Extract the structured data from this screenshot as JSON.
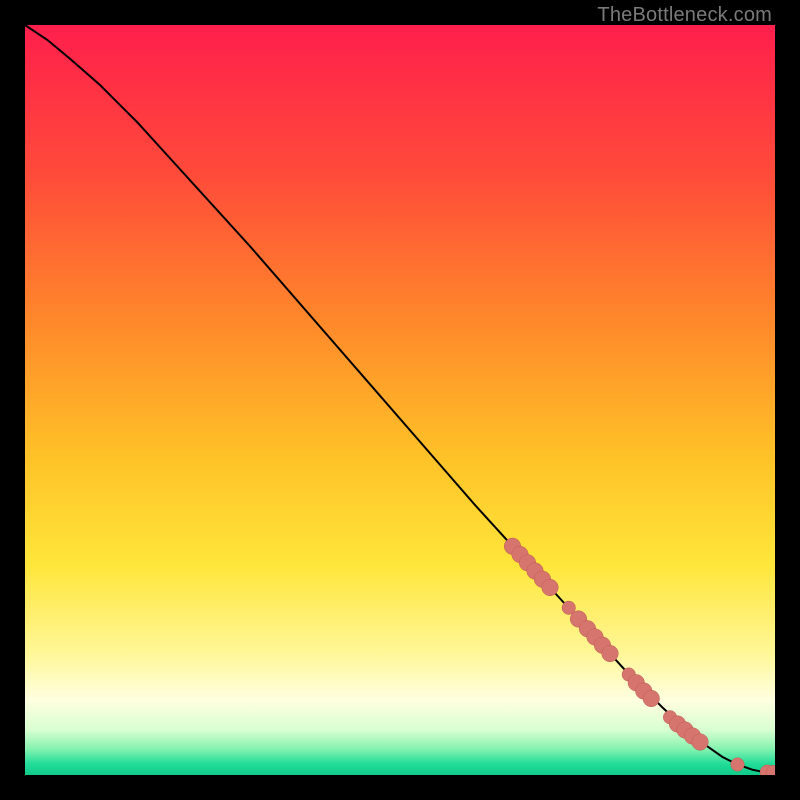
{
  "watermark": "TheBottleneck.com",
  "colors": {
    "frame": "#000000",
    "marker_fill": "#d6756e",
    "marker_stroke": "#c05a52",
    "curve": "#000000",
    "gradient_stops": [
      {
        "offset": 0.0,
        "color": "#ff1f4c"
      },
      {
        "offset": 0.2,
        "color": "#ff4b3a"
      },
      {
        "offset": 0.4,
        "color": "#ff8a2a"
      },
      {
        "offset": 0.58,
        "color": "#ffc328"
      },
      {
        "offset": 0.72,
        "color": "#ffe63a"
      },
      {
        "offset": 0.84,
        "color": "#fff79a"
      },
      {
        "offset": 0.9,
        "color": "#ffffe0"
      },
      {
        "offset": 0.94,
        "color": "#d8ffd0"
      },
      {
        "offset": 0.965,
        "color": "#86f2b0"
      },
      {
        "offset": 0.985,
        "color": "#22dd99"
      },
      {
        "offset": 1.0,
        "color": "#10c98a"
      }
    ]
  },
  "chart_data": {
    "type": "line",
    "title": "",
    "xlabel": "",
    "ylabel": "",
    "xlim": [
      0,
      100
    ],
    "ylim": [
      0,
      100
    ],
    "series": [
      {
        "name": "curve",
        "x": [
          0,
          3,
          6,
          10,
          15,
          20,
          30,
          40,
          50,
          60,
          65,
          70,
          75,
          80,
          85,
          88,
          91,
          93,
          95,
          97,
          98.5,
          100
        ],
        "y": [
          100,
          98,
          95.5,
          92,
          87,
          81.5,
          70.5,
          59,
          47.5,
          36,
          30.5,
          25,
          19.5,
          14,
          9,
          6.2,
          3.8,
          2.4,
          1.4,
          0.7,
          0.4,
          0.3
        ]
      }
    ],
    "markers": [
      {
        "x": 65.0,
        "y": 30.5,
        "r": 1.1
      },
      {
        "x": 66.0,
        "y": 29.4,
        "r": 1.1
      },
      {
        "x": 67.0,
        "y": 28.3,
        "r": 1.1
      },
      {
        "x": 68.0,
        "y": 27.2,
        "r": 1.1
      },
      {
        "x": 69.0,
        "y": 26.1,
        "r": 1.1
      },
      {
        "x": 70.0,
        "y": 25.0,
        "r": 1.1
      },
      {
        "x": 72.5,
        "y": 22.3,
        "r": 0.9
      },
      {
        "x": 73.8,
        "y": 20.8,
        "r": 1.1
      },
      {
        "x": 75.0,
        "y": 19.5,
        "r": 1.1
      },
      {
        "x": 76.0,
        "y": 18.4,
        "r": 1.1
      },
      {
        "x": 77.0,
        "y": 17.3,
        "r": 1.1
      },
      {
        "x": 78.0,
        "y": 16.2,
        "r": 1.1
      },
      {
        "x": 80.5,
        "y": 13.4,
        "r": 0.9
      },
      {
        "x": 81.5,
        "y": 12.3,
        "r": 1.1
      },
      {
        "x": 82.5,
        "y": 11.2,
        "r": 1.1
      },
      {
        "x": 83.5,
        "y": 10.2,
        "r": 1.1
      },
      {
        "x": 86.0,
        "y": 7.7,
        "r": 0.9
      },
      {
        "x": 87.0,
        "y": 6.8,
        "r": 1.1
      },
      {
        "x": 88.0,
        "y": 6.0,
        "r": 1.1
      },
      {
        "x": 89.0,
        "y": 5.2,
        "r": 1.1
      },
      {
        "x": 90.0,
        "y": 4.4,
        "r": 1.1
      },
      {
        "x": 95.0,
        "y": 1.4,
        "r": 0.9
      },
      {
        "x": 99.0,
        "y": 0.35,
        "r": 1.0
      },
      {
        "x": 99.8,
        "y": 0.3,
        "r": 1.0
      }
    ]
  }
}
